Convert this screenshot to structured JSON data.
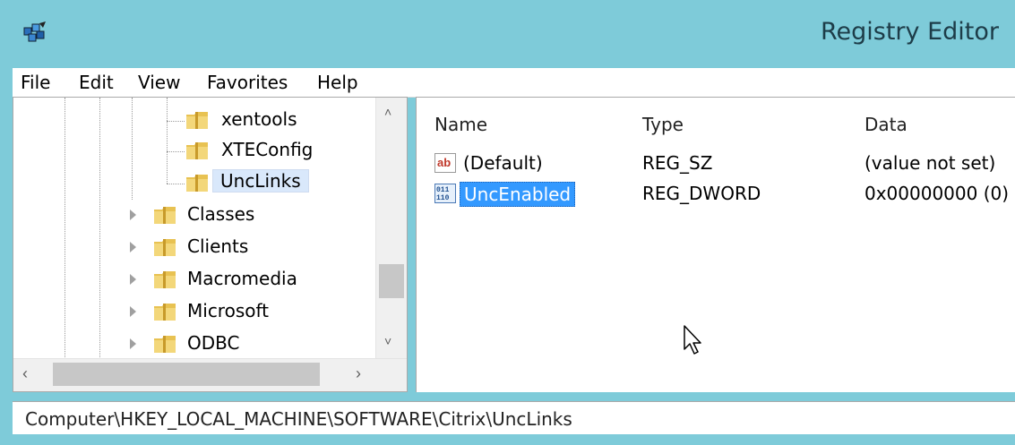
{
  "window": {
    "title": "Registry Editor",
    "app_icon": "registry-editor-icon"
  },
  "menu": [
    "File",
    "Edit",
    "View",
    "Favorites",
    "Help"
  ],
  "tree": {
    "items": [
      {
        "label": "xentools",
        "level": "child",
        "expandable": false,
        "selected": false
      },
      {
        "label": "XTEConfig",
        "level": "child",
        "expandable": false,
        "selected": false
      },
      {
        "label": "UncLinks",
        "level": "child",
        "expandable": false,
        "selected": true
      },
      {
        "label": "Classes",
        "level": "parent",
        "expandable": true,
        "selected": false
      },
      {
        "label": "Clients",
        "level": "parent",
        "expandable": true,
        "selected": false
      },
      {
        "label": "Macromedia",
        "level": "parent",
        "expandable": true,
        "selected": false
      },
      {
        "label": "Microsoft",
        "level": "parent",
        "expandable": true,
        "selected": false
      },
      {
        "label": "ODBC",
        "level": "parent",
        "expandable": true,
        "selected": false
      }
    ]
  },
  "list": {
    "columns": {
      "name": "Name",
      "type": "Type",
      "data": "Data"
    },
    "rows": [
      {
        "icon": "string-value-icon",
        "name": "(Default)",
        "type": "REG_SZ",
        "data": "(value not set)",
        "selected": false
      },
      {
        "icon": "binary-value-icon",
        "name": "UncEnabled",
        "type": "REG_DWORD",
        "data": "0x00000000 (0)",
        "selected": true
      }
    ]
  },
  "status": {
    "path": "Computer\\HKEY_LOCAL_MACHINE\\SOFTWARE\\Citrix\\UncLinks"
  },
  "colors": {
    "titlebar": "#7ecbd9",
    "selection": "#3399ff",
    "tree_selection": "#d9e8fb"
  }
}
